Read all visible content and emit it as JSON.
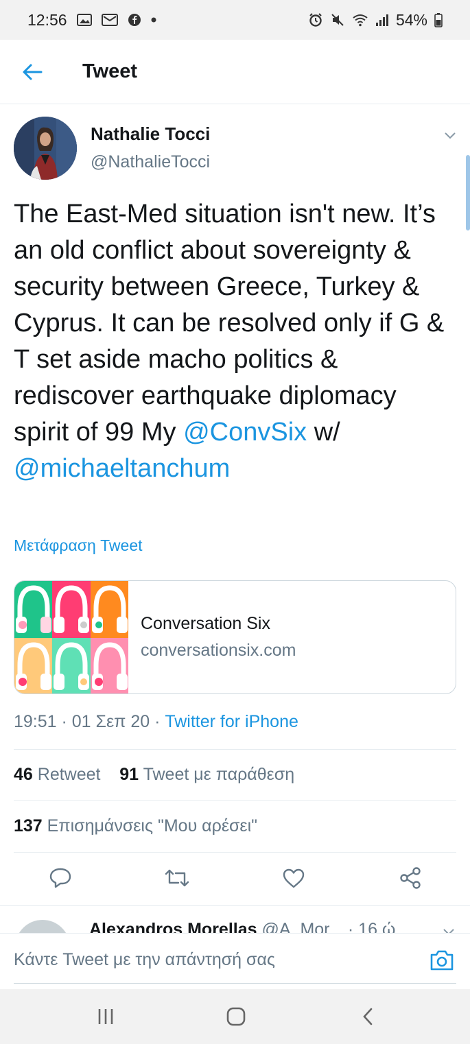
{
  "status_bar": {
    "time": "12:56",
    "battery": "54%",
    "left_icons": [
      "image-icon",
      "mail-icon",
      "facebook-icon",
      "dot-icon"
    ],
    "right_icons": [
      "alarm-icon",
      "mute-icon",
      "wifi-icon",
      "signal-icon",
      "battery-icon"
    ]
  },
  "header": {
    "title": "Tweet"
  },
  "tweet": {
    "author_name": "Nathalie Tocci",
    "author_handle": "@NathalieTocci",
    "text_plain": "The East-Med situation isn't new. It’s an old conflict about sovereignty & security between Greece, Turkey & Cyprus. It can be resolved only if G & T set aside macho politics & rediscover earthquake diplomacy spirit of 99 My ",
    "mention1": "@ConvSix",
    "text_between": " w/ ",
    "mention2": "@michaeltanchum",
    "translate_label": "Μετάφραση Tweet",
    "card": {
      "title": "Conversation Six",
      "domain": "conversationsix.com"
    },
    "timestamp": "19:51 · 01 Σεπ 20 · ",
    "source": "Twitter for iPhone",
    "retweets_count": "46",
    "retweets_label": "Retweet",
    "quotes_count": "91",
    "quotes_label": "Tweet με παράθεση",
    "likes_count": "137",
    "likes_label": "Επισημάνσεις \"Μου αρέσει\""
  },
  "next_reply": {
    "name": "Alexandros Morellas",
    "handle": "@A_Mor... · 16 ώ"
  },
  "reply_bar": {
    "placeholder": "Κάντε Tweet με την απάντησή σας"
  },
  "colors": {
    "accent": "#1b95e0",
    "muted": "#657786",
    "text": "#14171a"
  }
}
